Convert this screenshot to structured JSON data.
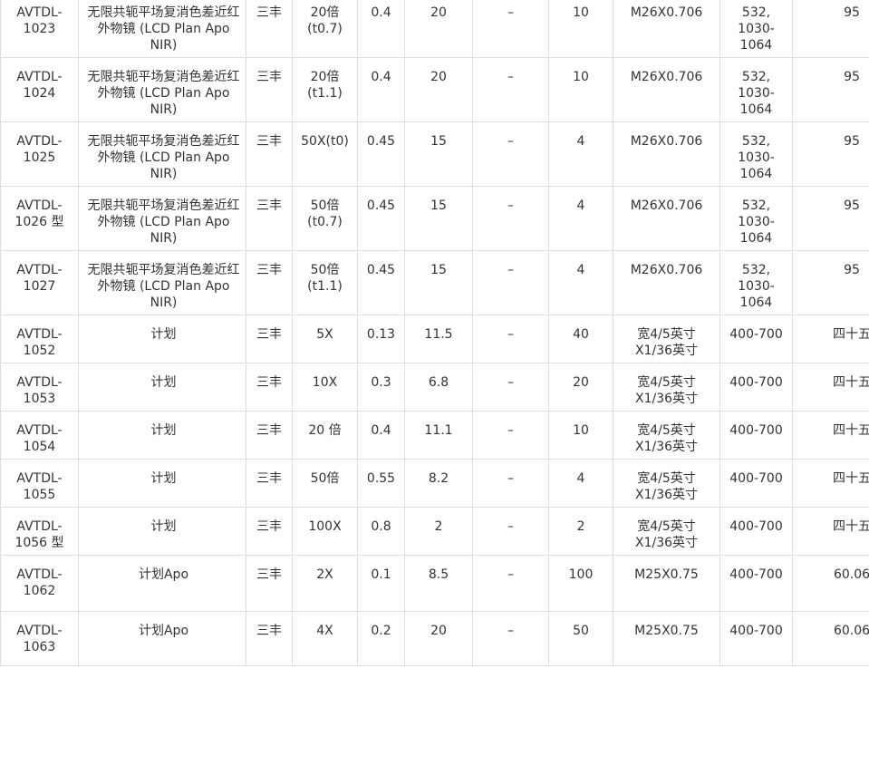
{
  "table": {
    "rows": [
      {
        "model": "AVTDL-1023",
        "name": "无限共轭平场复消色差近红外物镜 (LCD Plan Apo NIR)",
        "brand": "三丰",
        "magnification": "20倍(t0.7)",
        "na": "0.4",
        "wd": "20",
        "dash": "–",
        "focal": "10",
        "thread": "M26X0.706",
        "wavelength": "532, 1030-1064",
        "last": "95"
      },
      {
        "model": "AVTDL-1024",
        "name": "无限共轭平场复消色差近红外物镜 (LCD Plan Apo NIR)",
        "brand": "三丰",
        "magnification": "20倍(t1.1)",
        "na": "0.4",
        "wd": "20",
        "dash": "–",
        "focal": "10",
        "thread": "M26X0.706",
        "wavelength": "532, 1030-1064",
        "last": "95"
      },
      {
        "model": "AVTDL-1025",
        "name": "无限共轭平场复消色差近红外物镜 (LCD Plan Apo NIR)",
        "brand": "三丰",
        "magnification": "50X(t0)",
        "na": "0.45",
        "wd": "15",
        "dash": "–",
        "focal": "4",
        "thread": "M26X0.706",
        "wavelength": "532, 1030-1064",
        "last": "95"
      },
      {
        "model": "AVTDL-1026 型",
        "name": "无限共轭平场复消色差近红外物镜 (LCD Plan Apo NIR)",
        "brand": "三丰",
        "magnification": "50倍(t0.7)",
        "na": "0.45",
        "wd": "15",
        "dash": "–",
        "focal": "4",
        "thread": "M26X0.706",
        "wavelength": "532, 1030-1064",
        "last": "95"
      },
      {
        "model": "AVTDL-1027",
        "name": "无限共轭平场复消色差近红外物镜 (LCD Plan Apo NIR)",
        "brand": "三丰",
        "magnification": "50倍(t1.1)",
        "na": "0.45",
        "wd": "15",
        "dash": "–",
        "focal": "4",
        "thread": "M26X0.706",
        "wavelength": "532, 1030-1064",
        "last": "95"
      },
      {
        "model": "AVTDL-1052",
        "name": "计划",
        "brand": "三丰",
        "magnification": "5X",
        "na": "0.13",
        "wd": "11.5",
        "dash": "–",
        "focal": "40",
        "thread": "宽4/5英寸 X1/36英寸",
        "wavelength": "400-700",
        "last": "四十五"
      },
      {
        "model": "AVTDL-1053",
        "name": "计划",
        "brand": "三丰",
        "magnification": "10X",
        "na": "0.3",
        "wd": "6.8",
        "dash": "–",
        "focal": "20",
        "thread": "宽4/5英寸 X1/36英寸",
        "wavelength": "400-700",
        "last": "四十五"
      },
      {
        "model": "AVTDL-1054",
        "name": "计划",
        "brand": "三丰",
        "magnification": "20 倍",
        "na": "0.4",
        "wd": "11.1",
        "dash": "–",
        "focal": "10",
        "thread": "宽4/5英寸 X1/36英寸",
        "wavelength": "400-700",
        "last": "四十五"
      },
      {
        "model": "AVTDL-1055",
        "name": "计划",
        "brand": "三丰",
        "magnification": "50倍",
        "na": "0.55",
        "wd": "8.2",
        "dash": "–",
        "focal": "4",
        "thread": "宽4/5英寸 X1/36英寸",
        "wavelength": "400-700",
        "last": "四十五"
      },
      {
        "model": "AVTDL-1056 型",
        "name": "计划",
        "brand": "三丰",
        "magnification": "100X",
        "na": "0.8",
        "wd": "2",
        "dash": "–",
        "focal": "2",
        "thread": "宽4/5英寸 X1/36英寸",
        "wavelength": "400-700",
        "last": "四十五"
      },
      {
        "model": "AVTDL-1062",
        "name": "计划Apo",
        "brand": "三丰",
        "magnification": "2X",
        "na": "0.1",
        "wd": "8.5",
        "dash": "–",
        "focal": "100",
        "thread": "M25X0.75",
        "wavelength": "400-700",
        "last": "60.06"
      },
      {
        "model": "AVTDL-1063",
        "name": "计划Apo",
        "brand": "三丰",
        "magnification": "4X",
        "na": "0.2",
        "wd": "20",
        "dash": "–",
        "focal": "50",
        "thread": "M25X0.75",
        "wavelength": "400-700",
        "last": "60.06"
      }
    ]
  }
}
